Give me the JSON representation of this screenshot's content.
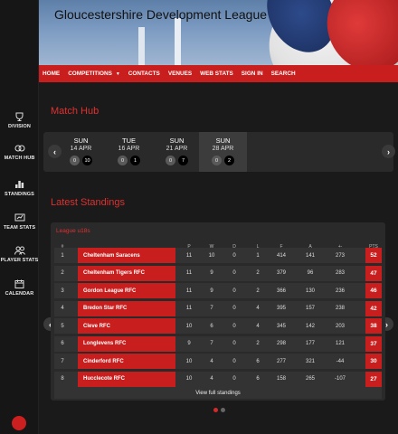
{
  "site": {
    "title": "Gloucestershire Development League"
  },
  "nav": [
    "HOME",
    "COMPETITIONS",
    "CONTACTS",
    "VENUES",
    "WEB STATS",
    "SIGN IN",
    "SEARCH"
  ],
  "sidebar": [
    {
      "label": "DIVISION",
      "icon": "trophy-icon"
    },
    {
      "label": "MATCH HUB",
      "icon": "match-hub-icon"
    },
    {
      "label": "STANDINGS",
      "icon": "standings-icon"
    },
    {
      "label": "TEAM STATS",
      "icon": "team-stats-icon"
    },
    {
      "label": "PLAYER STATS",
      "icon": "player-stats-icon"
    },
    {
      "label": "CALENDAR",
      "icon": "calendar-icon"
    }
  ],
  "match_hub": {
    "title": "Match Hub",
    "days": [
      {
        "day": "SUN",
        "date": "14 APR",
        "a": "0",
        "b": "10"
      },
      {
        "day": "TUE",
        "date": "16 APR",
        "a": "0",
        "b": "1"
      },
      {
        "day": "SUN",
        "date": "21 APR",
        "a": "0",
        "b": "7"
      },
      {
        "day": "SUN",
        "date": "28 APR",
        "a": "0",
        "b": "2"
      }
    ]
  },
  "standings": {
    "title": "Latest Standings",
    "league": "League u18s",
    "columns": [
      "#",
      "P",
      "W",
      "D",
      "L",
      "F",
      "A",
      "+-",
      "PTS"
    ],
    "rows": [
      {
        "pos": "1",
        "team": "Cheltenham Saracens",
        "p": "11",
        "w": "10",
        "d": "0",
        "l": "1",
        "f": "414",
        "a": "141",
        "diff": "273",
        "pts": "52"
      },
      {
        "pos": "2",
        "team": "Cheltenham Tigers RFC",
        "p": "11",
        "w": "9",
        "d": "0",
        "l": "2",
        "f": "379",
        "a": "96",
        "diff": "283",
        "pts": "47"
      },
      {
        "pos": "3",
        "team": "Gordon League RFC",
        "p": "11",
        "w": "9",
        "d": "0",
        "l": "2",
        "f": "366",
        "a": "130",
        "diff": "236",
        "pts": "46"
      },
      {
        "pos": "4",
        "team": "Bredon Star RFC",
        "p": "11",
        "w": "7",
        "d": "0",
        "l": "4",
        "f": "395",
        "a": "157",
        "diff": "238",
        "pts": "42"
      },
      {
        "pos": "5",
        "team": "Cleve RFC",
        "p": "10",
        "w": "6",
        "d": "0",
        "l": "4",
        "f": "345",
        "a": "142",
        "diff": "203",
        "pts": "38"
      },
      {
        "pos": "6",
        "team": "Longlevens RFC",
        "p": "9",
        "w": "7",
        "d": "0",
        "l": "2",
        "f": "298",
        "a": "177",
        "diff": "121",
        "pts": "37"
      },
      {
        "pos": "7",
        "team": "Cinderford RFC",
        "p": "10",
        "w": "4",
        "d": "0",
        "l": "6",
        "f": "277",
        "a": "321",
        "diff": "-44",
        "pts": "30"
      },
      {
        "pos": "8",
        "team": "Hucclecote RFC",
        "p": "10",
        "w": "4",
        "d": "0",
        "l": "6",
        "f": "158",
        "a": "265",
        "diff": "-107",
        "pts": "27"
      }
    ],
    "view_full": "View full standings"
  },
  "colors": {
    "accent": "#c81e1e",
    "background": "#1a1a1a",
    "panel": "#2a2a2a"
  }
}
